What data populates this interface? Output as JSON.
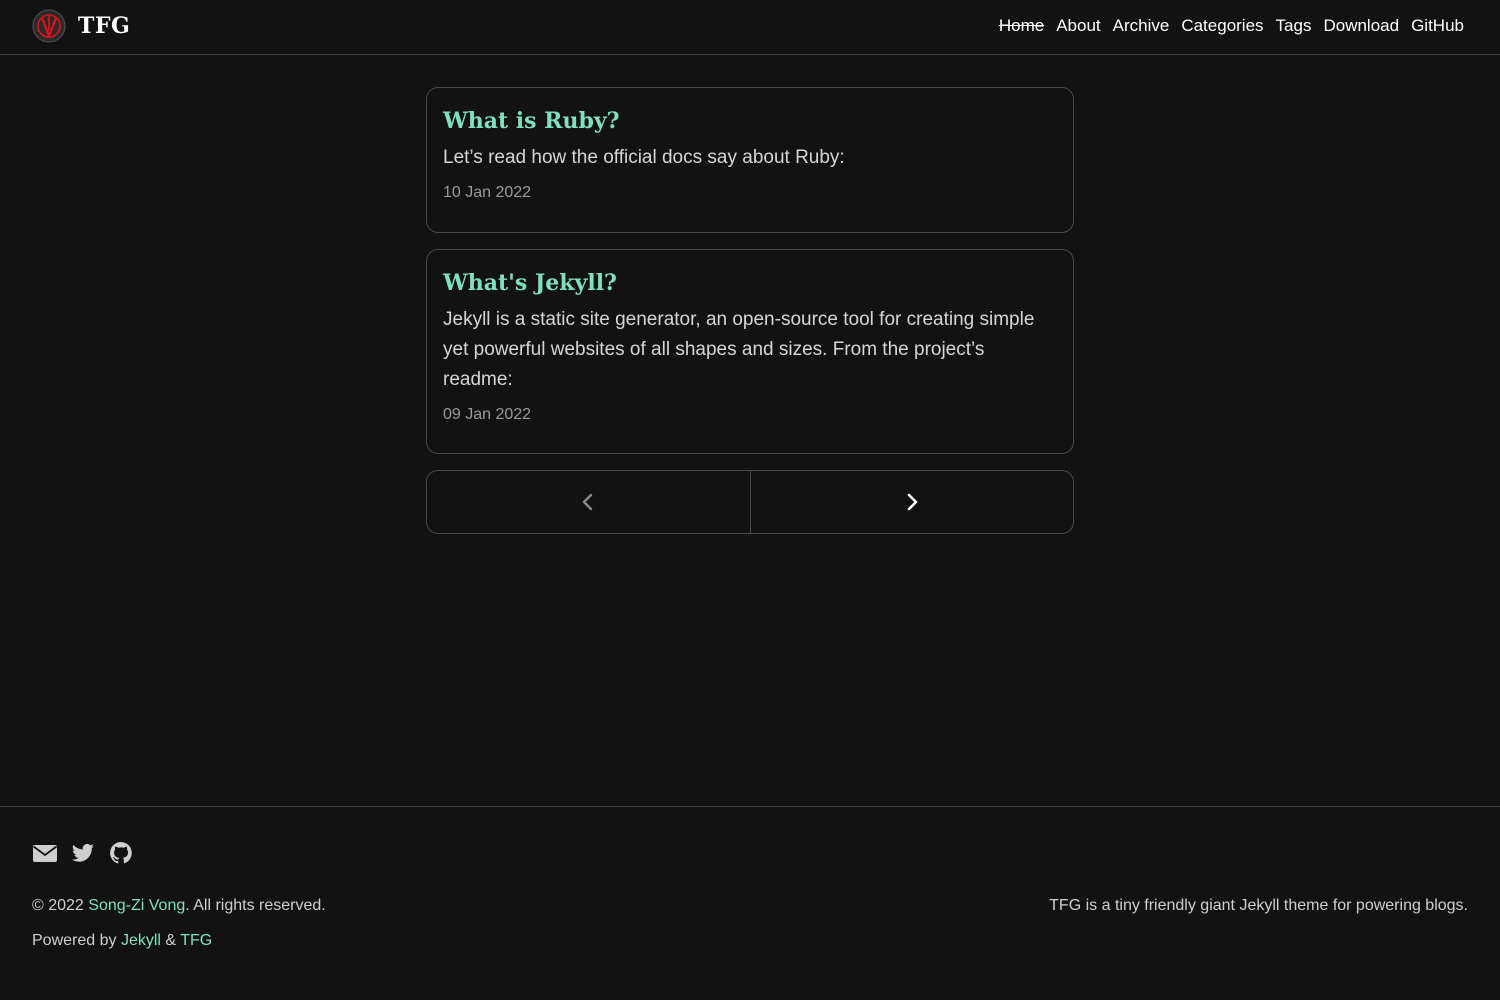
{
  "header": {
    "brand": "TFG",
    "nav": [
      "Home",
      "About",
      "Archive",
      "Categories",
      "Tags",
      "Download",
      "GitHub"
    ]
  },
  "posts": [
    {
      "title": "What is Ruby?",
      "excerpt": "Let’s read how the official docs say about Ruby:",
      "date": "10 Jan 2022"
    },
    {
      "title": "What's Jekyll?",
      "excerpt": "Jekyll is a static site generator, an open-source tool for creating simple yet powerful websites of all shapes and sizes. From the project’s readme:",
      "date": "09 Jan 2022"
    }
  ],
  "pagination": {
    "prev_icon": "chevron-left-icon",
    "next_icon": "chevron-right-icon"
  },
  "footer": {
    "social_icons": [
      "envelope-icon",
      "twitter-icon",
      "github-icon"
    ],
    "copyright_prefix": "© 2022",
    "author": "Song-Zi Vong",
    "copyright_suffix": ". All rights reserved.",
    "powered_prefix": "Powered by",
    "powered_jekyll": "Jekyll",
    "powered_amp": "&",
    "powered_tfg": "TFG",
    "tagline": "TFG is a tiny friendly giant Jekyll theme for powering blogs."
  },
  "colors": {
    "background": "#121212",
    "accent": "#7fe0c0",
    "logo_red": "#e0121b"
  }
}
